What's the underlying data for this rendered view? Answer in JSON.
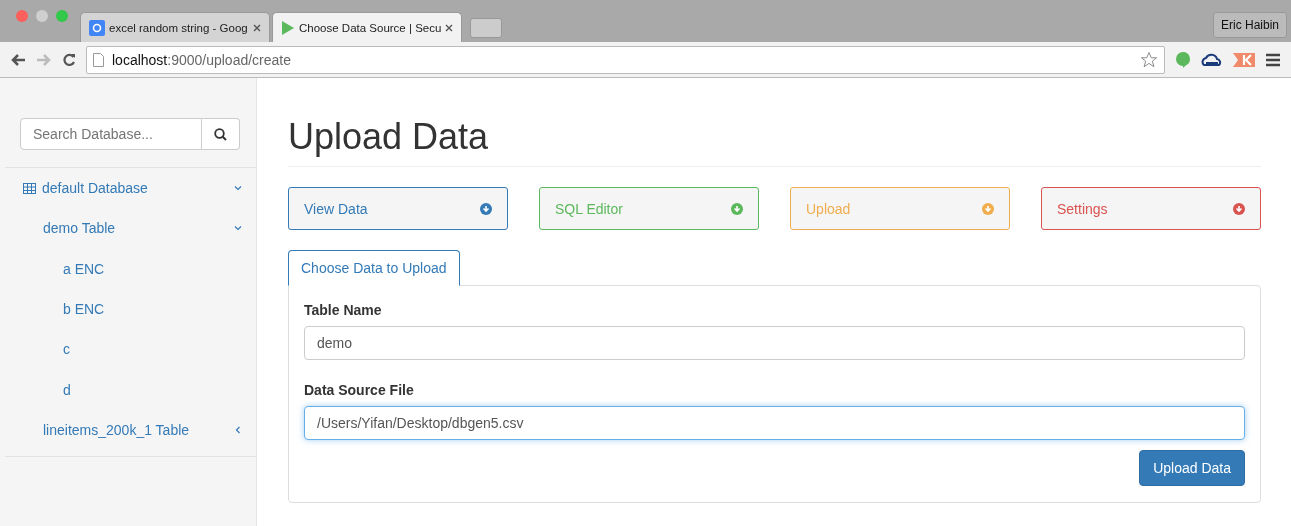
{
  "browser": {
    "tabs": [
      {
        "title": "excel random string - Goog",
        "kind": "google",
        "selected": false
      },
      {
        "title": "Choose Data Source | Secu",
        "kind": "play",
        "selected": true
      }
    ],
    "profile": "Eric Haibin",
    "address": {
      "host": "localhost",
      "path": ":9000/upload/create"
    }
  },
  "sidebar": {
    "search": {
      "placeholder": "Search Database..."
    },
    "tree": [
      {
        "label": "default Database",
        "expanded": true,
        "children": [
          {
            "label": "demo Table",
            "expanded": true,
            "children": [
              {
                "label": "a ENC"
              },
              {
                "label": "b ENC"
              },
              {
                "label": "c"
              },
              {
                "label": "d"
              }
            ]
          },
          {
            "label": "lineitems_200k_1 Table",
            "expanded": false
          }
        ]
      }
    ]
  },
  "main": {
    "title": "Upload Data",
    "panels": [
      {
        "label": "View Data",
        "color": "#337ab7"
      },
      {
        "label": "SQL Editor",
        "color": "#5cb85c"
      },
      {
        "label": "Upload",
        "color": "#f0ad4e"
      },
      {
        "label": "Settings",
        "color": "#d9534f"
      }
    ],
    "tab": "Choose Data to Upload",
    "form": {
      "fields": [
        {
          "label": "Table Name",
          "value": "demo",
          "focused": false
        },
        {
          "label": "Data Source File",
          "value": "/Users/Yifan/Desktop/dbgen5.csv",
          "focused": true
        }
      ],
      "submit": "Upload Data"
    }
  }
}
